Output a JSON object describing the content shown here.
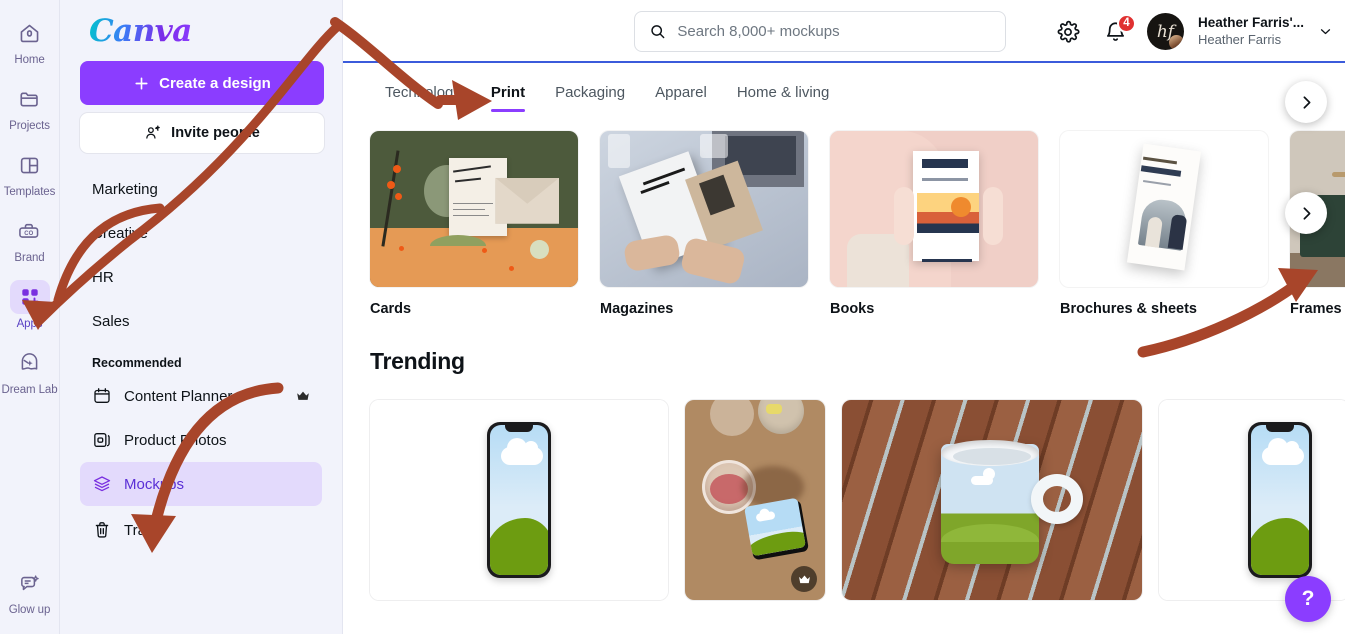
{
  "rail": {
    "items": [
      {
        "label": "Home",
        "icon": "home-icon",
        "active": false
      },
      {
        "label": "Projects",
        "icon": "folder-icon",
        "active": false
      },
      {
        "label": "Templates",
        "icon": "templates-icon",
        "active": false
      },
      {
        "label": "Brand",
        "icon": "brand-briefcase-icon",
        "active": false
      },
      {
        "label": "Apps",
        "icon": "apps-grid-icon",
        "active": true
      },
      {
        "label": "Dream Lab",
        "icon": "dream-lab-icon",
        "active": false
      },
      {
        "label": "Glow up",
        "icon": "glow-up-icon",
        "active": false
      }
    ]
  },
  "sidebar": {
    "logo": "Canva",
    "create_label": "Create a design",
    "invite_label": "Invite people",
    "nav": [
      {
        "label": "Marketing",
        "active": false,
        "icon": null,
        "pro": false
      },
      {
        "label": "Creative",
        "active": false,
        "icon": null,
        "pro": false
      },
      {
        "label": "HR",
        "active": false,
        "icon": null,
        "pro": false
      },
      {
        "label": "Sales",
        "active": false,
        "icon": null,
        "pro": false
      }
    ],
    "recommended_title": "Recommended",
    "recommended": [
      {
        "label": "Content Planner",
        "active": false,
        "icon": "calendar-icon",
        "pro": true
      },
      {
        "label": "Product Photos",
        "active": false,
        "icon": "product-photos-icon",
        "pro": false
      },
      {
        "label": "Mockups",
        "active": true,
        "icon": "layers-icon",
        "pro": false
      }
    ],
    "trash": {
      "label": "Trash",
      "icon": "trash-icon"
    }
  },
  "header": {
    "search_placeholder": "Search 8,000+ mockups",
    "search_value": "",
    "settings_icon": "gear-icon",
    "notifications_icon": "bell-icon",
    "notification_count": "4",
    "avatar_initials": "hf",
    "account_name": "Heather Farris'...",
    "user_name": "Heather Farris",
    "chevron_icon": "chevron-down-icon"
  },
  "tabs": [
    {
      "label": "Technology",
      "active": false
    },
    {
      "label": "Print",
      "active": true
    },
    {
      "label": "Packaging",
      "active": false
    },
    {
      "label": "Apparel",
      "active": false
    },
    {
      "label": "Home & living",
      "active": false
    }
  ],
  "categories": [
    {
      "label": "Cards",
      "thumb": "cards-wedding-invite-photo"
    },
    {
      "label": "Magazines",
      "thumb": "magazine-sephir-photo"
    },
    {
      "label": "Books",
      "thumb": "book-sunset-dreaming-photo"
    },
    {
      "label": "Brochures & sheets",
      "thumb": "wedding-organizer-brochure-photo"
    },
    {
      "label": "Frames",
      "thumb": "frame-room-photo"
    }
  ],
  "trending": {
    "title": "Trending",
    "items": [
      {
        "thumb": "phone-mockup-white-bg",
        "pro": false
      },
      {
        "thumb": "coaster-drink-photo",
        "pro": true
      },
      {
        "thumb": "mug-wooden-table-photo",
        "pro": false
      },
      {
        "thumb": "phone-mockup-white-bg-2",
        "pro": false
      }
    ]
  },
  "controls": {
    "next_categories_label": "›",
    "next_trending_label": "›",
    "help_label": "?"
  },
  "colors": {
    "accent_purple": "#8b3dff",
    "active_nav_bg": "#e3dafc",
    "active_nav_text": "#5a2fd6",
    "sidebar_bg": "#f2f3fb",
    "badge_red": "#e03131",
    "topbar_border": "#3b5bdb",
    "annotation_arrow": "#a8452a"
  }
}
